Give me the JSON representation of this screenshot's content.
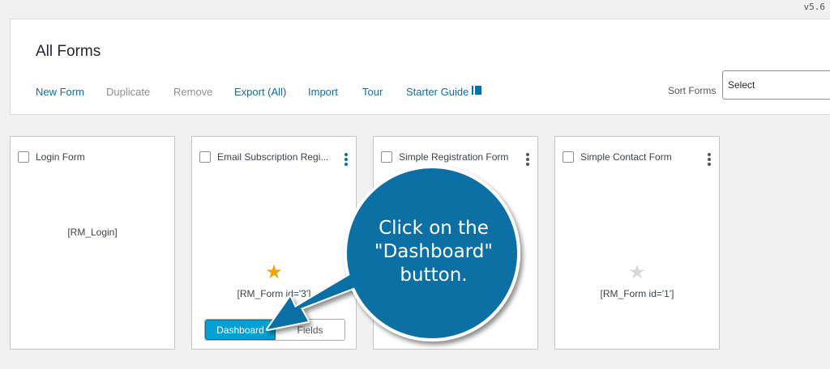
{
  "version": "v5.6",
  "header": {
    "title": "All Forms",
    "toolbar": {
      "new_form": "New Form",
      "duplicate": "Duplicate",
      "remove": "Remove",
      "export": "Export (All)",
      "import": "Import",
      "tour": "Tour",
      "starter_guide": "Starter Guide"
    },
    "sort_label": "Sort Forms",
    "sort_value": "Select"
  },
  "cards": [
    {
      "title": "Login Form",
      "shortcode": "[RM_Login]"
    },
    {
      "title": "Email Subscription Regi...",
      "shortcode": "[RM_Form id='3']",
      "starred": true,
      "dashboard_label": "Dashboard",
      "fields_label": "Fields"
    },
    {
      "title": "Simple Registration Form"
    },
    {
      "title": "Simple Contact Form",
      "shortcode": "[RM_Form id='1']",
      "starred": false
    }
  ],
  "callout": {
    "line1": "Click on the",
    "line2": "\"Dashboard\"",
    "line3": "button."
  },
  "colors": {
    "accent": "#0073aa",
    "dashboard_button": "#00a0d2",
    "star_active": "#f0a30a",
    "star_inactive": "#d8d8d8",
    "callout_fill": "#0a6fa4"
  }
}
